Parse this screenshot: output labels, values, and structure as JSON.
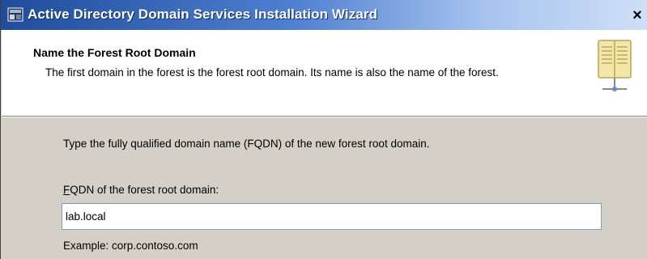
{
  "window": {
    "title": "Active Directory Domain Services Installation Wizard",
    "close_glyph": "×"
  },
  "header": {
    "title": "Name the Forest Root Domain",
    "description": "The first domain in the forest is the forest root domain. Its name is also the name of the forest.",
    "icon": "book-icon"
  },
  "body": {
    "instruction": "Type the fully qualified domain name (FQDN) of the new forest root domain.",
    "fqdn_label_access_key": "F",
    "fqdn_label_rest": "QDN of the forest root domain:",
    "fqdn_value": "lab.local",
    "example": "Example: corp.contoso.com"
  }
}
